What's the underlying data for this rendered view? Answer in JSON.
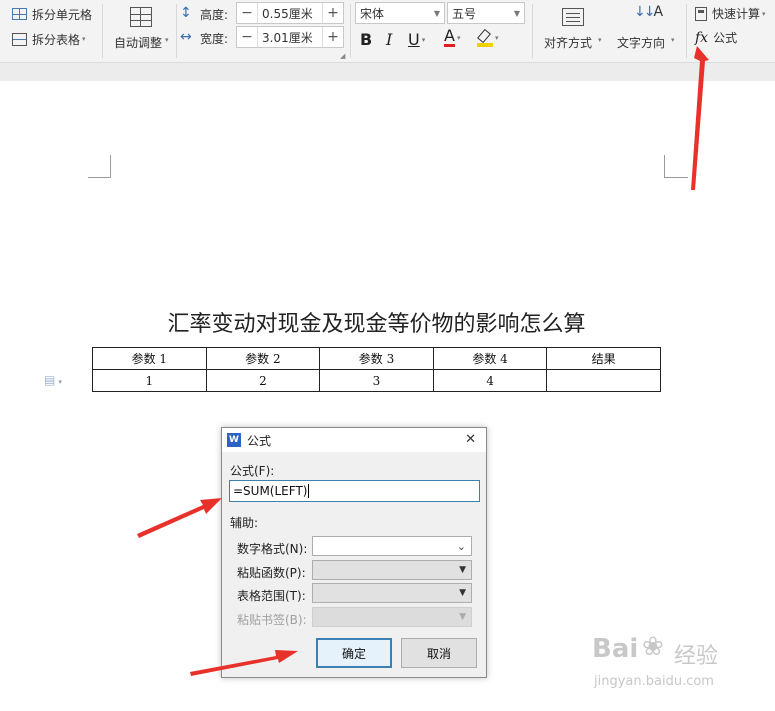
{
  "ribbon": {
    "split_cells_label": "拆分单元格",
    "split_table_label": "拆分表格",
    "auto_fit_label": "自动调整",
    "height_label": "高度:",
    "height_value": "0.55厘米",
    "width_label": "宽度:",
    "width_value": "3.01厘米",
    "minus": "−",
    "plus": "+",
    "font_name": "宋体",
    "font_size": "五号",
    "bold": "B",
    "italic": "I",
    "underline": "U",
    "font_color": "A",
    "align_label": "对齐方式",
    "text_direction_label": "文字方向",
    "quick_calc_label": "快速计算",
    "fx_glyph": "fx",
    "formula_label": "公式"
  },
  "document": {
    "title": "汇率变动对现金及现金等价物的影响怎么算",
    "table": {
      "header": [
        "参数 1",
        "参数 2",
        "参数 3",
        "参数 4",
        "结果"
      ],
      "rows": [
        [
          "1",
          "2",
          "3",
          "4",
          ""
        ]
      ]
    }
  },
  "dialog": {
    "title": "公式",
    "formula_label": "公式(F):",
    "formula_value": "=SUM(LEFT)",
    "assist_label": "辅助:",
    "number_format_label": "数字格式(N):",
    "paste_function_label": "粘贴函数(P):",
    "table_range_label": "表格范围(T):",
    "paste_bookmark_label": "粘贴书签(B):",
    "ok_label": "确定",
    "cancel_label": "取消",
    "close_glyph": "✕"
  },
  "watermark": {
    "brand": "Bai",
    "brand_suffix": "经验",
    "url": "jingyan.baidu.com"
  },
  "colors": {
    "arrow": "#e8312a",
    "dialog_primary_border": "#3c7fb1",
    "formula_border": "#3c7fb1"
  }
}
